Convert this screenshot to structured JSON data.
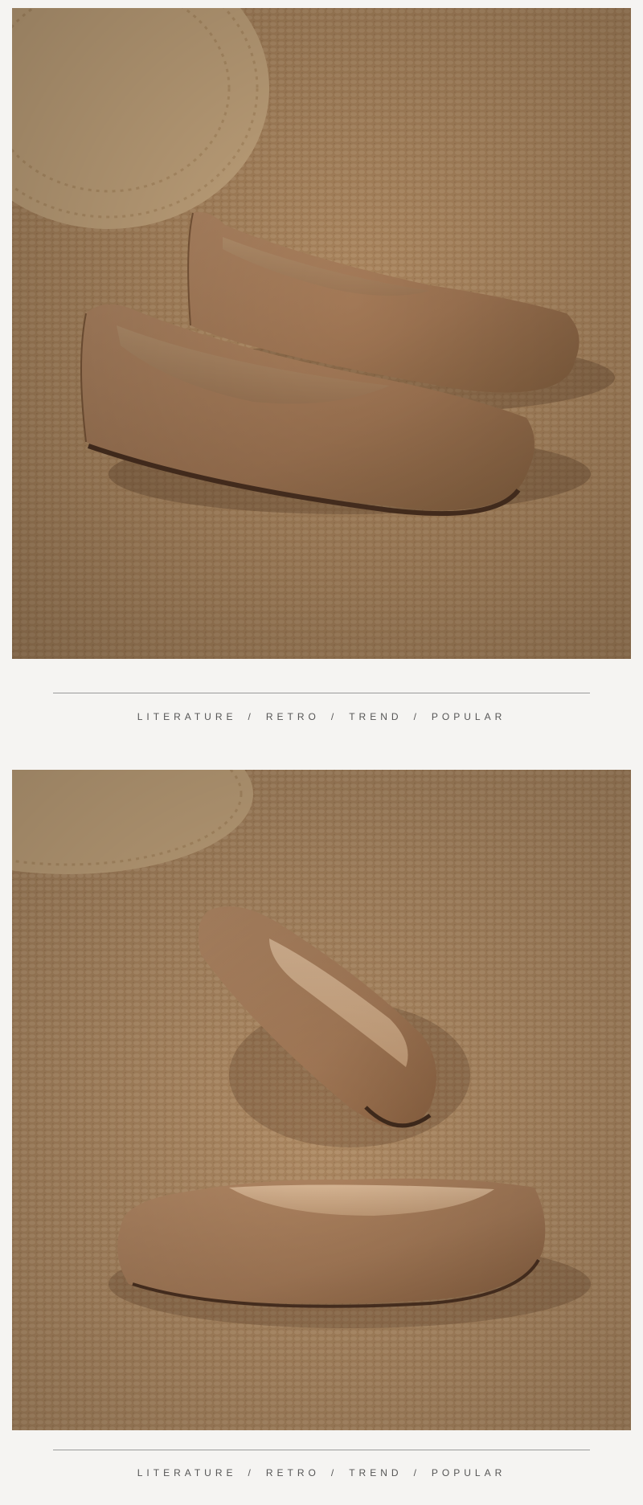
{
  "sections": [
    {
      "tagline": {
        "items": [
          "LITERATURE",
          "RETRO",
          "TREND",
          "POPULAR"
        ],
        "separator": "/"
      }
    },
    {
      "tagline": {
        "items": [
          "LITERATURE",
          "RETRO",
          "TREND",
          "POPULAR"
        ],
        "separator": "/"
      }
    }
  ],
  "colors": {
    "background": "#f5f4f2",
    "carpet": "#a8835c",
    "leather": "#a57a58",
    "rule": "#9a9a9a",
    "text": "#555555"
  }
}
